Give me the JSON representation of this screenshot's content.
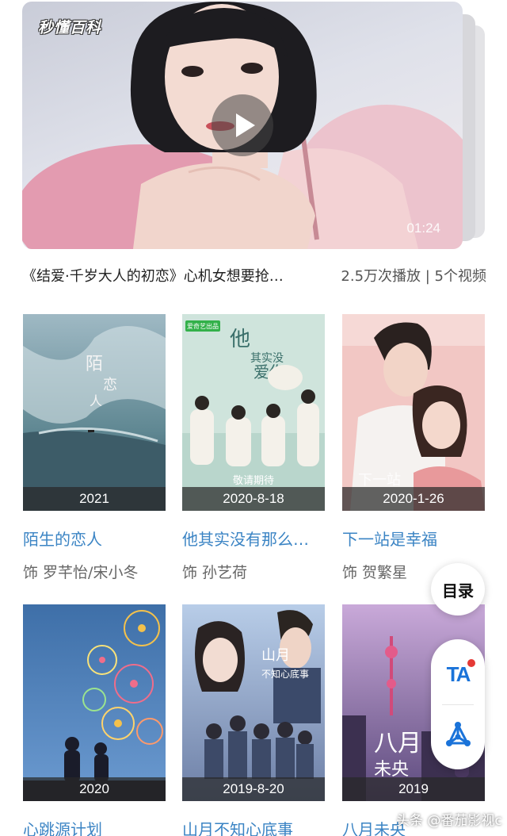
{
  "video": {
    "watermark": "秒懂百科",
    "duration": "01:24",
    "title": "《结爱·千岁大人的初恋》心机女想要抢…",
    "stats": "2.5万次播放 | 5个视频"
  },
  "dramas": [
    {
      "date": "2021",
      "title": "陌生的恋人",
      "cast": "饰 罗芊怡/宋小冬",
      "poster_text": "陌生人恋"
    },
    {
      "date": "2020-8-18",
      "title": "他其实没有那么…",
      "cast": "饰 孙艺荷",
      "poster_text": "他其实没那么爱你",
      "poster_sub": "敬请期待",
      "badge": "爱奇艺出品"
    },
    {
      "date": "2020-1-26",
      "title": "下一站是幸福",
      "cast": "饰 贺繁星",
      "poster_text": "下一站"
    },
    {
      "date": "2020",
      "title": "心跳源计划",
      "cast": "",
      "poster_text": ""
    },
    {
      "date": "2019-8-20",
      "title": "山月不知心底事",
      "cast": "",
      "poster_text": "山月不知心底事"
    },
    {
      "date": "2019",
      "title": "八月未央",
      "cast": "",
      "poster_text": "八月未央"
    }
  ],
  "side": {
    "toc_label": "目录",
    "ta_label": "TA"
  },
  "attribution": "头条 @番茄影视c",
  "colors": {
    "link": "#3b84c4",
    "ta_blue": "#1a73d9",
    "dot_red": "#e53935"
  }
}
